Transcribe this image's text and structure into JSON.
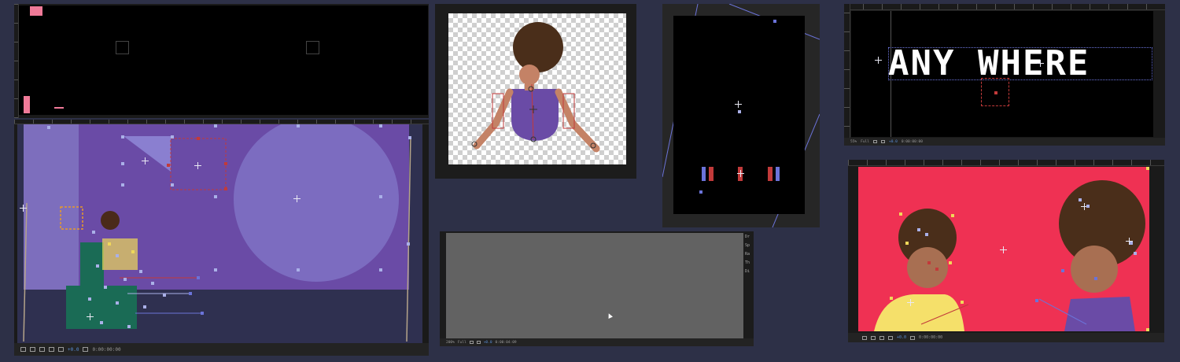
{
  "panel_a": {
    "toolbar": {
      "zoom": ""
    }
  },
  "panel_main": {
    "toolbar": {
      "value": "+0.0",
      "timecode": "0:00:00:00"
    }
  },
  "panel_character": {},
  "panel_gray": {
    "toolbar": {
      "zoom": "200%",
      "quality": "Full",
      "value": "+0.0",
      "timecode": "0:00:04:09"
    },
    "side_labels": [
      "Dr",
      "Sp",
      "Ra",
      "Th",
      "Di"
    ]
  },
  "panel_vertical": {},
  "panel_text": {
    "title_text": "ANY WHERE",
    "toolbar": {
      "zoom": "55%",
      "quality": "Full",
      "value": "+0.0",
      "timecode": "0:00:00:00"
    }
  },
  "panel_red": {
    "toolbar": {
      "value": "+0.0",
      "timecode": "0:00:00:00"
    }
  },
  "colors": {
    "background": "#2d3047",
    "purple_scene": "#6a4ba6",
    "red_scene": "#ef3153",
    "handle": "#aab0e8",
    "accent_blue": "#5a8fd8"
  }
}
